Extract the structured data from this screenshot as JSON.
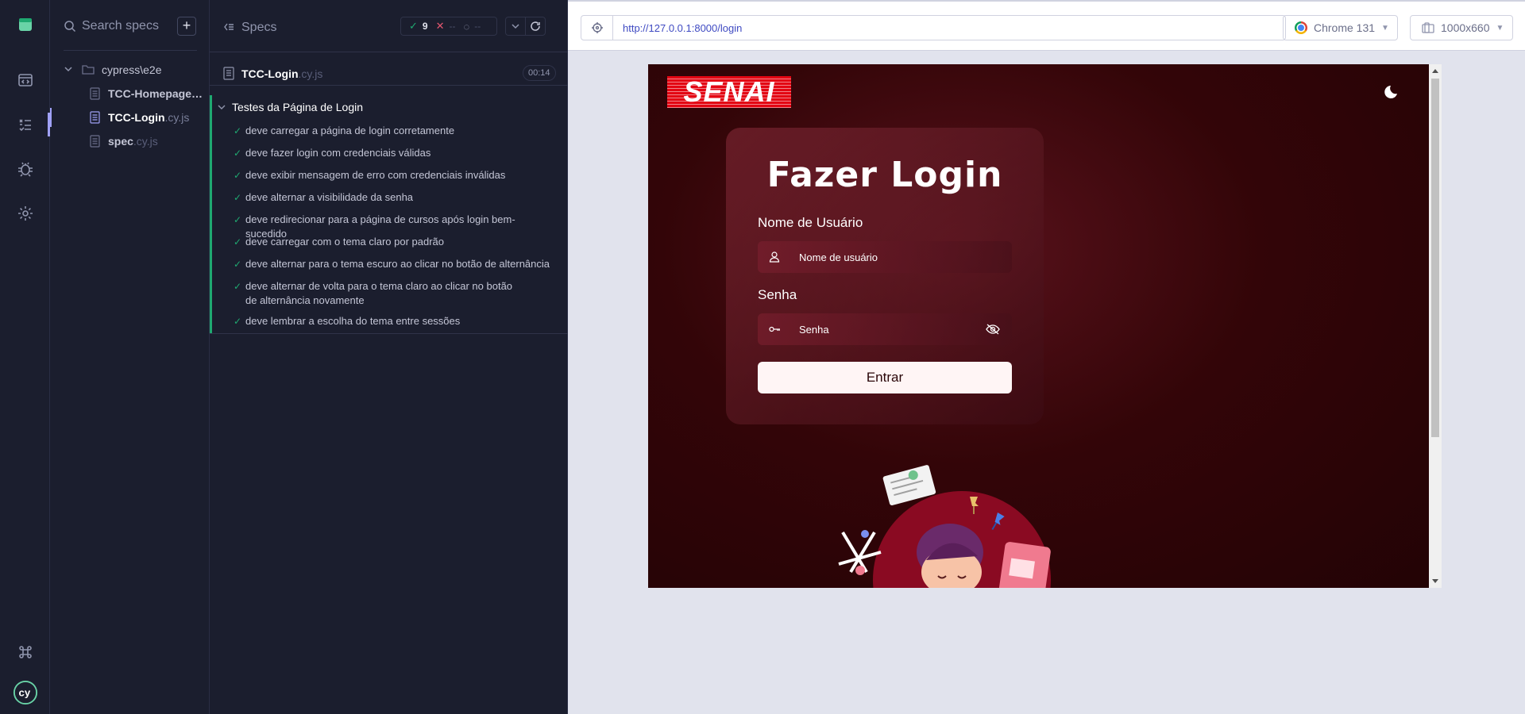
{
  "colors": {
    "sidebar_bg": "#1b1e2e",
    "pass": "#1fa971",
    "fail": "#e45770",
    "accent": "#a0a1f6",
    "url_text": "#3f4ac2",
    "aut_bg": "#2a0508",
    "senai_red": "#e30613"
  },
  "rail": {
    "icons": [
      "cypress-app-icon",
      "specs-icon",
      "runs-icon",
      "debug-icon",
      "settings-icon",
      "keyboard-shortcuts-icon",
      "cypress-logo-icon"
    ]
  },
  "specs_panel": {
    "search_placeholder": "Search specs",
    "add_label": "+",
    "folder": "cypress\\e2e",
    "files": [
      {
        "name": "TCC-Homepage",
        "ext": ".cy.js",
        "active": false
      },
      {
        "name": "TCC-Login",
        "ext": ".cy.js",
        "active": true
      },
      {
        "name": "spec",
        "ext": ".cy.js",
        "active": false
      }
    ]
  },
  "reporter": {
    "title": "Specs",
    "stats": {
      "passed": "9",
      "failed": "--",
      "pending": "--"
    },
    "spec_file": {
      "name": "TCC-Login",
      "ext": ".cy.js"
    },
    "duration": "00:14",
    "suite": {
      "title": "Testes da Página de Login",
      "tests": [
        "deve carregar a página de login corretamente",
        "deve fazer login com credenciais válidas",
        "deve exibir mensagem de erro com credenciais inválidas",
        "deve alternar a visibilidade da senha",
        "deve redirecionar para a página de cursos após login bem-sucedido",
        "deve carregar com o tema claro por padrão",
        "deve alternar para o tema escuro ao clicar no botão de alternância",
        "deve alternar de volta para o tema claro ao clicar no botão de alternância novamente",
        "deve lembrar a escolha do tema entre sessões"
      ]
    }
  },
  "browser": {
    "url": "http://127.0.0.1:8000/login",
    "browser_label": "Chrome 131",
    "viewport_label": "1000x660"
  },
  "aut": {
    "logo_text": "SENAI",
    "login_title": "Fazer Login",
    "username_label": "Nome de Usuário",
    "username_placeholder": "Nome de usuário",
    "password_label": "Senha",
    "password_placeholder": "Senha",
    "submit_label": "Entrar"
  }
}
